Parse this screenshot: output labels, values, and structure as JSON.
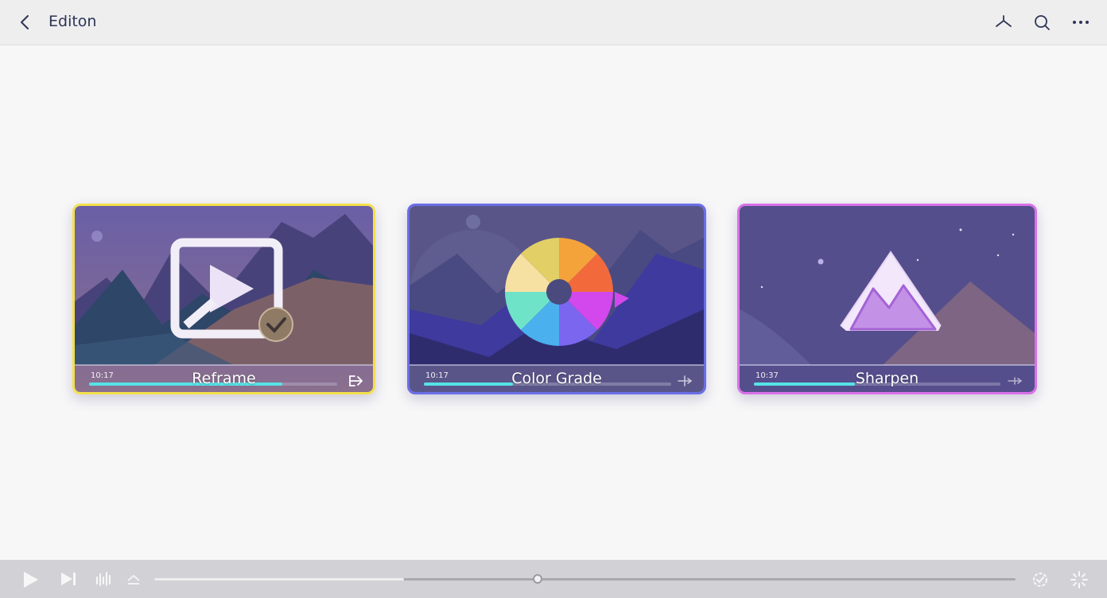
{
  "header": {
    "title": "Editon",
    "icons": [
      "back-chevron-icon",
      "tool-icon",
      "search-icon",
      "more-icon"
    ]
  },
  "cards": [
    {
      "label": "Reframe",
      "time": "10:17",
      "progress": 0.78,
      "border": "#f4e04a",
      "icon": "reframe-icon",
      "action_icon": "export-arrow-icon"
    },
    {
      "label": "Color Grade",
      "time": "10:17",
      "progress": 0.36,
      "border": "#6a6ee8",
      "icon": "color-wheel-icon",
      "action_icon": "split-icon"
    },
    {
      "label": "Sharpen",
      "time": "10:37",
      "progress": 0.41,
      "border": "#d972e8",
      "icon": "mountain-icon",
      "action_icon": "split-icon"
    }
  ],
  "playback": {
    "progress": 0.29,
    "icons": [
      "play-icon",
      "skip-next-icon",
      "waveform-icon",
      "eject-icon",
      "settings-icon",
      "expand-icon"
    ]
  },
  "colors": {
    "accent": "#56e3e6",
    "card_bg": "#5a4f86",
    "topbar": "#eeeeef",
    "bottombar": "#d2d2d6"
  }
}
